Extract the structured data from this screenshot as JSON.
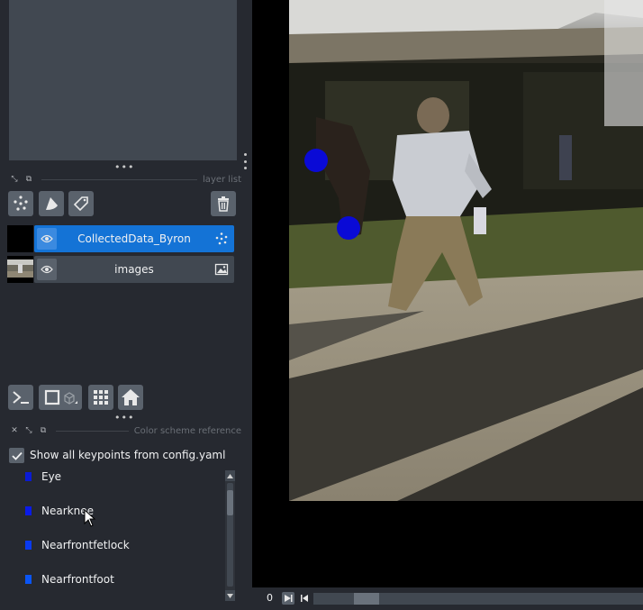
{
  "layer_list": {
    "title": "layer list",
    "layers": [
      {
        "name": "CollectedData_Byron",
        "selected": true,
        "type_icon": "points-icon"
      },
      {
        "name": "images",
        "selected": false,
        "type_icon": "image-icon"
      }
    ]
  },
  "tools": {
    "new_points": "points-icon",
    "new_shapes": "shapes-icon",
    "new_labels": "labels-icon",
    "delete": "trash-icon"
  },
  "viewer_buttons": {
    "console": "console-icon",
    "ndisplay": "ndisplay-icon",
    "grid": "grid-icon",
    "home": "home-icon"
  },
  "color_scheme": {
    "title": "Color scheme reference",
    "show_all_label": "Show all keypoints from config.yaml",
    "show_all_checked": true,
    "keypoints": [
      {
        "name": "Eye",
        "color": "#0a1bd6"
      },
      {
        "name": "Nearknee",
        "color": "#0a1be8"
      },
      {
        "name": "Nearfrontfetlock",
        "color": "#0a3af0"
      },
      {
        "name": "Nearfrontfoot",
        "color": "#0a55f5"
      }
    ]
  },
  "dims": {
    "frame": "0",
    "slider_value": 0.12
  },
  "colors": {
    "accent": "#1473d6",
    "panel": "#262930",
    "widget": "#414851",
    "button": "#5a626c",
    "keypoint_marker": "#0a0ad6"
  }
}
